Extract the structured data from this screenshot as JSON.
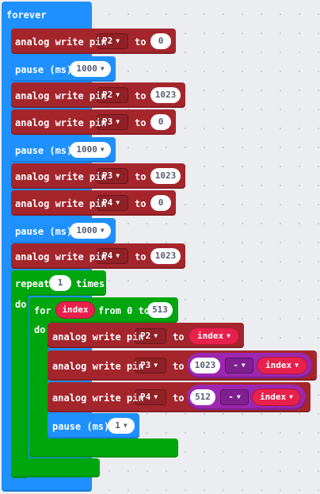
{
  "forever": {
    "label": "forever"
  },
  "common": {
    "analog_write_pin": "analog write pin",
    "to": "to",
    "pause": "pause (ms)"
  },
  "blocks": [
    {
      "pin": "P2",
      "value": "0"
    },
    {
      "pause": "1000"
    },
    {
      "pin": "P2",
      "value": "1023"
    },
    {
      "pin": "P3",
      "value": "0"
    },
    {
      "pause": "1000"
    },
    {
      "pin": "P3",
      "value": "1023"
    },
    {
      "pin": "P4",
      "value": "0"
    },
    {
      "pause": "1000"
    },
    {
      "pin": "P4",
      "value": "1023"
    }
  ],
  "repeat": {
    "label": "repeat",
    "count": "1",
    "times": "times",
    "do": "do"
  },
  "for_loop": {
    "label": "for",
    "variable": "index",
    "from": "from 0 to",
    "to_value": "513",
    "do": "do"
  },
  "inner": {
    "b1": {
      "pin": "P2",
      "variable": "index"
    },
    "b2": {
      "pin": "P3",
      "left": "1023",
      "op": "-",
      "variable": "index"
    },
    "b3": {
      "pin": "P4",
      "left": "512",
      "op": "-",
      "variable": "index"
    },
    "pause": "1"
  },
  "colors": {
    "event": "#1e90ff",
    "pins": "#a4262c",
    "loops": "#00a60e",
    "math": "#9c27b0",
    "variable": "#e8204c",
    "workspace": "#ecedf0"
  }
}
